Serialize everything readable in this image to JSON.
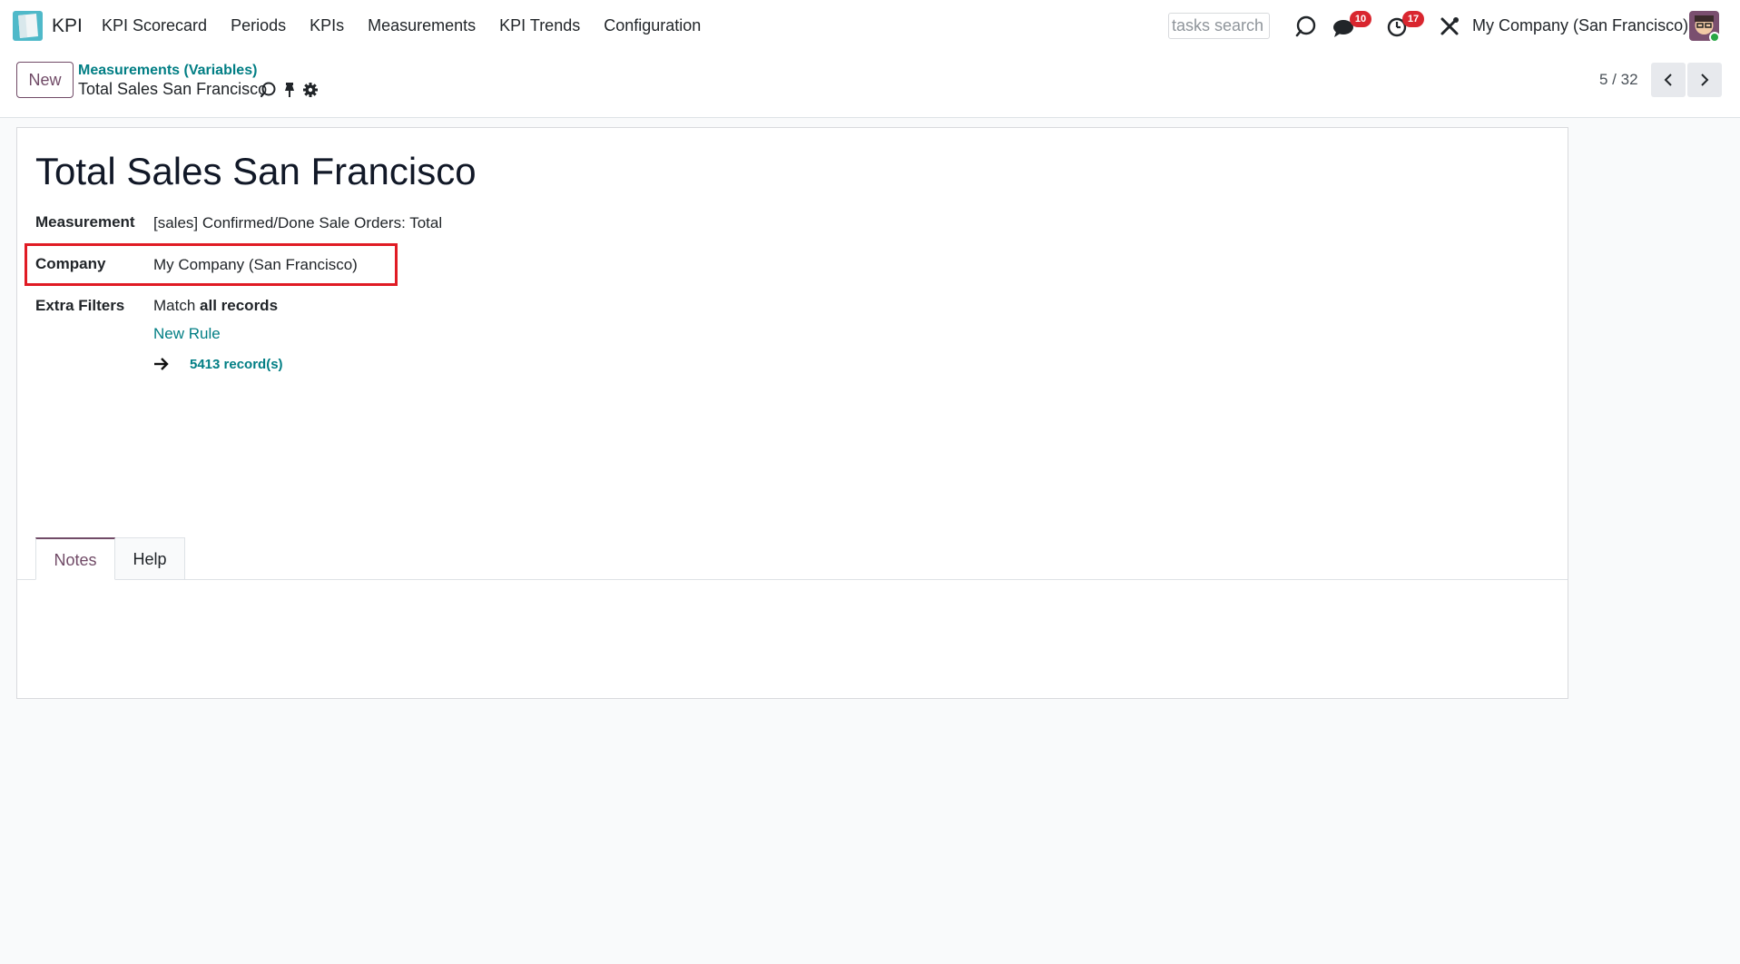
{
  "navbar": {
    "app_name": "KPI",
    "menu": [
      "KPI Scorecard",
      "Periods",
      "KPIs",
      "Measurements",
      "KPI Trends",
      "Configuration"
    ],
    "search_placeholder": "tasks search",
    "messages_count": "10",
    "activities_count": "17",
    "company": "My Company (San Francisco)"
  },
  "control_panel": {
    "new_label": "New",
    "breadcrumb_parent": "Measurements (Variables)",
    "breadcrumb_current": "Total Sales San Francisco",
    "pager": "5 / 32"
  },
  "form": {
    "title": "Total Sales San Francisco",
    "fields": {
      "measurement_label": "Measurement",
      "measurement_value": "[sales] Confirmed/Done Sale Orders: Total",
      "company_label": "Company",
      "company_value": "My Company (San Francisco)",
      "filters_label": "Extra Filters",
      "filters_prefix": "Match",
      "filters_bold": "all records",
      "new_rule": "New Rule",
      "records": "5413 record(s)"
    },
    "tabs": [
      "Notes",
      "Help"
    ]
  },
  "colors": {
    "brand": "#714b67",
    "link": "#017e84",
    "highlight": "#e01b24",
    "badge": "#d9262f"
  }
}
